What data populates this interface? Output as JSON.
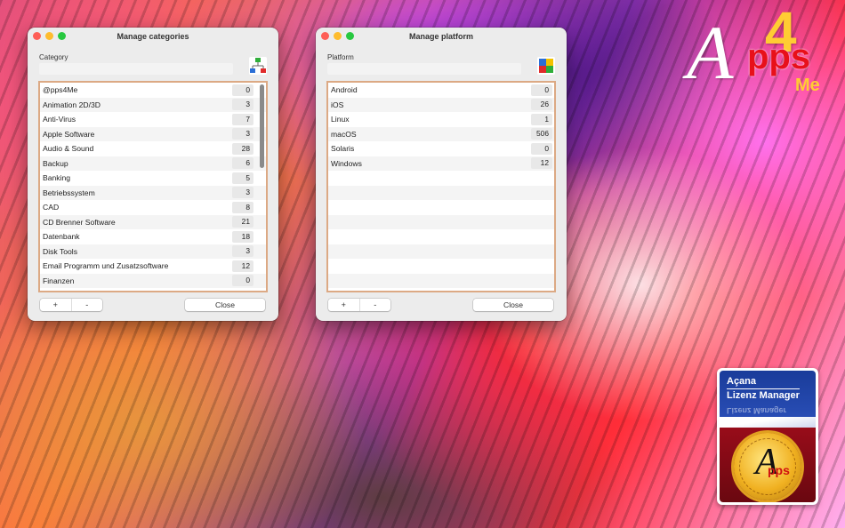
{
  "categories_window": {
    "title": "Manage categories",
    "field_label": "Category",
    "field_value": "",
    "items": [
      {
        "name": "@pps4Me",
        "count": "0"
      },
      {
        "name": "Animation 2D/3D",
        "count": "3"
      },
      {
        "name": "Anti-Virus",
        "count": "7"
      },
      {
        "name": "Apple Software",
        "count": "3"
      },
      {
        "name": "Audio & Sound",
        "count": "28"
      },
      {
        "name": "Backup",
        "count": "6"
      },
      {
        "name": "Banking",
        "count": "5"
      },
      {
        "name": "Betriebssystem",
        "count": "3"
      },
      {
        "name": "CAD",
        "count": "8"
      },
      {
        "name": "CD Brenner Software",
        "count": "21"
      },
      {
        "name": "Datenbank",
        "count": "18"
      },
      {
        "name": "Disk Tools",
        "count": "3"
      },
      {
        "name": "Email Programm und Zusatzsoftware",
        "count": "12"
      },
      {
        "name": "Finanzen",
        "count": "0"
      }
    ],
    "add_label": "+",
    "remove_label": "-",
    "close_label": "Close",
    "icon": "category-tree-icon"
  },
  "platform_window": {
    "title": "Manage platform",
    "field_label": "Platform",
    "field_value": "",
    "items": [
      {
        "name": "Android",
        "count": "0"
      },
      {
        "name": "iOS",
        "count": "26"
      },
      {
        "name": "Linux",
        "count": "1"
      },
      {
        "name": "macOS",
        "count": "506"
      },
      {
        "name": "Solaris",
        "count": "0"
      },
      {
        "name": "Windows",
        "count": "12"
      },
      {
        "name": "",
        "count": ""
      },
      {
        "name": "",
        "count": ""
      },
      {
        "name": "",
        "count": ""
      },
      {
        "name": "",
        "count": ""
      },
      {
        "name": "",
        "count": ""
      },
      {
        "name": "",
        "count": ""
      },
      {
        "name": "",
        "count": ""
      },
      {
        "name": "",
        "count": ""
      }
    ],
    "add_label": "+",
    "remove_label": "-",
    "close_label": "Close",
    "icon": "puzzle-blocks-icon"
  },
  "logo": {
    "letter_a": "A",
    "digit_4": "4",
    "pps": "pps",
    "me": "Me"
  },
  "badge": {
    "line1": "Açana",
    "line2": "Lizenz Manager",
    "reflection": "Lizenz Manager",
    "seal_letter": "A",
    "seal_pps": "pps"
  },
  "colors": {
    "list_border": "#dca984",
    "close_dot": "#fe5f57",
    "minimize_dot": "#febc2e",
    "zoom_dot": "#28c840"
  }
}
